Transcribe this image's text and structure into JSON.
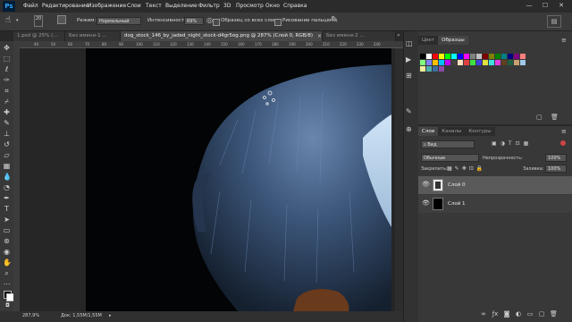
{
  "app": {
    "logo": "Ps"
  },
  "menu": [
    "Файл",
    "Редактирование",
    "Изображение",
    "Слои",
    "Текст",
    "Выделение",
    "Фильтр",
    "3D",
    "Просмотр",
    "Окно",
    "Справка"
  ],
  "window_controls": [
    "—",
    "☐",
    "✕"
  ],
  "options": {
    "brush_size": "20",
    "mode_label": "Режим:",
    "mode_value": "Нормальный",
    "intensity_label": "Интенсивность:",
    "intensity_value": "69%",
    "sample_all_label": "Образец со всех слоев",
    "finger_paint_label": "Рисование пальцем"
  },
  "tabs": [
    {
      "label": "1.psd @ 25% (..."
    },
    {
      "label": "Без имени-1 ..."
    },
    {
      "label": "dog_stock_146_by_jaded_night_stock-d4gr5og.png @ 287% (Слой 0, RGB/8)",
      "active": true
    },
    {
      "label": "Без имени-2 ..."
    }
  ],
  "rulers": {
    "top": [
      "40",
      "50",
      "60",
      "70",
      "80",
      "90",
      "100",
      "110",
      "120",
      "130",
      "140",
      "150",
      "160",
      "170",
      "180",
      "190",
      "200",
      "210",
      "220",
      "230",
      "240"
    ]
  },
  "status": {
    "zoom": "287,9%",
    "doc": "Док: 1,55M/1,55M"
  },
  "swatches_panel": {
    "tabs": [
      "Цвет",
      "Образцы"
    ],
    "colors": [
      "#000000",
      "#ffffff",
      "#ff0000",
      "#ffff00",
      "#00ff00",
      "#00ffff",
      "#0000ff",
      "#ff00ff",
      "#808080",
      "#c0c0c0",
      "#800000",
      "#808000",
      "#008000",
      "#008080",
      "#000080",
      "#800080",
      "#ff8080",
      "#80ff80",
      "#8080ff",
      "#ffc000",
      "#00c0ff",
      "#c000ff",
      "#404040",
      "#ffe0c0",
      "#e04040",
      "#40e040",
      "#4040e0",
      "#e0e040",
      "#40e0e0",
      "#e040e0",
      "#604020",
      "#206040",
      "#c8a070",
      "#a0c8e8",
      "#f0f0a0",
      "#50b0b0",
      "#3c6e9e",
      "#8e4aa5"
    ]
  },
  "layers_panel": {
    "tabs": [
      "Слои",
      "Каналы",
      "Контуры"
    ],
    "filter_label": "Вид",
    "blend_mode": "Обычные",
    "opacity_label": "Непрозрачность:",
    "opacity_value": "100%",
    "lock_label": "Закрепить:",
    "fill_label": "Заливка:",
    "fill_value": "100%",
    "layers": [
      {
        "name": "Слой 0",
        "selected": true
      },
      {
        "name": "Слой 1",
        "selected": false
      }
    ]
  },
  "colors": {
    "accent": "#31a8ff",
    "bg_dark": "#282828",
    "panel": "#383838"
  }
}
